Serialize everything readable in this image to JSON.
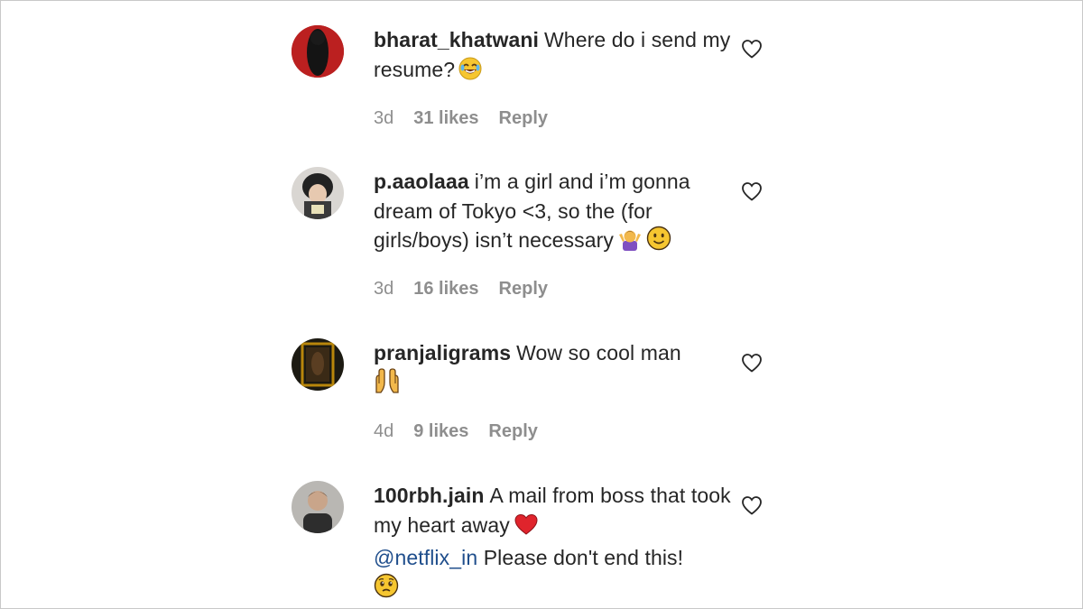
{
  "comments": [
    {
      "username": "bharat_khatwani",
      "text": "Where do i send my resume?",
      "emoji": "joy-emoji",
      "time": "3d",
      "likes": "31 likes",
      "reply": "Reply"
    },
    {
      "username": "p.aaolaaa",
      "text": "i’m a girl and i’m gonna dream of Tokyo <3, so the (for girls/boys) isn’t necessary",
      "emoji": "shrug-and-slight-smile-emoji",
      "time": "3d",
      "likes": "16 likes",
      "reply": "Reply"
    },
    {
      "username": "pranjaligrams",
      "text": "Wow so cool man",
      "emoji": "raised-hands-emoji",
      "time": "4d",
      "likes": "9 likes",
      "reply": "Reply"
    },
    {
      "username": "100rbh.jain",
      "text": "A mail from boss that took my heart away",
      "mention": "@netflix_in",
      "text2": "Please don't end this!",
      "emoji": "heart-and-pleading-emoji",
      "time": "",
      "likes": "",
      "reply": ""
    }
  ],
  "colors": {
    "text": "#262626",
    "meta": "#8e8e8e",
    "mention": "#1f4e8c",
    "border": "#c9c9c9"
  },
  "icons": {
    "like": "heart-outline-icon"
  }
}
